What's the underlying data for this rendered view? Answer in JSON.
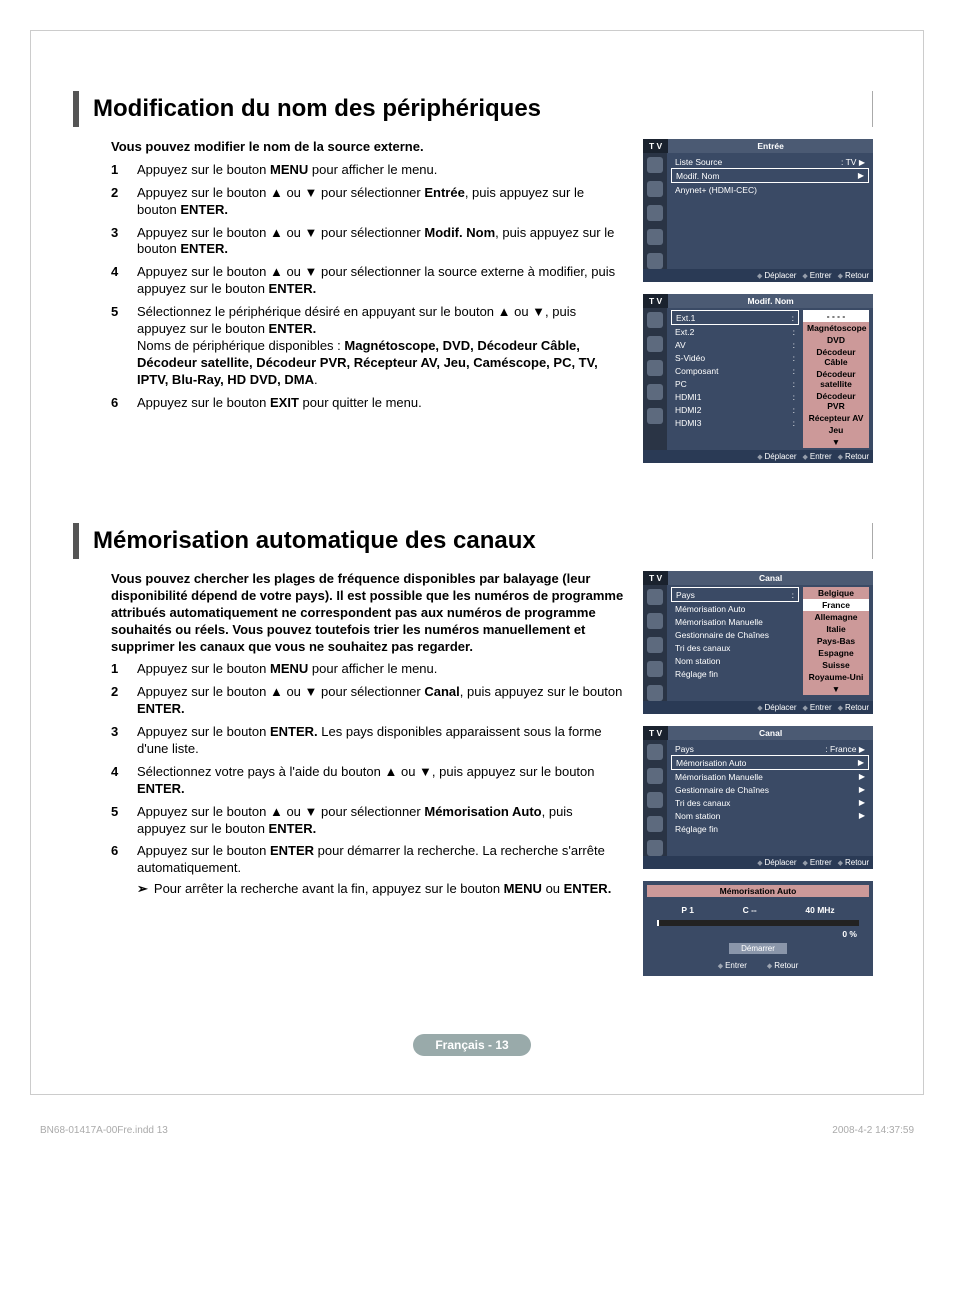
{
  "section1": {
    "title": "Modification du nom des périphériques",
    "intro": "Vous pouvez modifier le nom de la source externe.",
    "steps": [
      {
        "num": "1",
        "parts": [
          "Appuyez sur le bouton ",
          "MENU",
          " pour afficher le menu."
        ]
      },
      {
        "num": "2",
        "parts": [
          "Appuyez sur le bouton ▲ ou ▼ pour sélectionner ",
          "Entrée",
          ", puis appuyez sur le bouton ",
          "ENTER."
        ]
      },
      {
        "num": "3",
        "parts": [
          "Appuyez sur le bouton ▲ ou ▼ pour sélectionner ",
          "Modif. Nom",
          ", puis appuyez sur le bouton ",
          "ENTER."
        ]
      },
      {
        "num": "4",
        "parts": [
          "Appuyez sur le bouton ▲ ou ▼ pour sélectionner la source externe à modifier, puis appuyez sur le bouton ",
          "ENTER."
        ]
      },
      {
        "num": "5",
        "parts": [
          "Sélectionnez le périphérique désiré en appuyant sur le bouton ▲ ou ▼, puis appuyez sur le bouton ",
          "ENTER."
        ],
        "extra_intro": "Noms de périphérique disponibles : ",
        "extra_bold": "Magnétoscope, DVD, Décodeur Câble, Décodeur satellite, Décodeur PVR, Récepteur AV, Jeu, Caméscope, PC, TV, IPTV, Blu-Ray, HD DVD, DMA",
        "extra_suffix": "."
      },
      {
        "num": "6",
        "parts": [
          "Appuyez sur le bouton ",
          "EXIT",
          " pour quitter le menu."
        ]
      }
    ],
    "shot1": {
      "tab": "T V",
      "title": "Entrée",
      "rows": [
        {
          "label": "Liste Source",
          "val": ": TV",
          "arrow": "▶"
        },
        {
          "label": "Modif. Nom",
          "val": "",
          "arrow": "▶",
          "hl": true
        },
        {
          "label": "Anynet+ (HDMI-CEC)",
          "val": "",
          "arrow": ""
        }
      ]
    },
    "shot2": {
      "tab": "T V",
      "title": "Modif. Nom",
      "left": [
        "Ext.1",
        "Ext.2",
        "AV",
        "S-Vidéo",
        "Composant",
        "PC",
        "HDMI1",
        "HDMI2",
        "HDMI3"
      ],
      "right": [
        "- - - -",
        "Magnétoscope",
        "DVD",
        "Décodeur Câble",
        "Décodeur satellite",
        "Décodeur PVR",
        "Récepteur AV",
        "Jeu",
        "▼"
      ]
    },
    "footer": {
      "move": "Déplacer",
      "enter": "Entrer",
      "return": "Retour"
    }
  },
  "section2": {
    "title": "Mémorisation automatique des canaux",
    "intro": "Vous pouvez chercher les plages de fréquence disponibles par balayage (leur disponibilité dépend de votre pays). Il est possible que les numéros de programme attribués automatiquement ne correspondent pas aux numéros de programme souhaités ou réels. Vous pouvez toutefois trier les numéros manuellement et supprimer les canaux que vous ne souhaitez pas regarder.",
    "steps": [
      {
        "num": "1",
        "parts": [
          "Appuyez sur le bouton ",
          "MENU",
          " pour afficher le menu."
        ]
      },
      {
        "num": "2",
        "parts": [
          "Appuyez sur le bouton ▲ ou ▼ pour sélectionner ",
          "Canal",
          ", puis appuyez sur le bouton ",
          "ENTER."
        ]
      },
      {
        "num": "3",
        "parts": [
          "Appuyez sur le bouton ",
          "ENTER.",
          " Les pays disponibles apparaissent sous la forme d'une liste."
        ]
      },
      {
        "num": "4",
        "parts": [
          "Sélectionnez votre pays à l'aide du bouton ▲ ou ▼, puis appuyez sur le bouton ",
          "ENTER."
        ]
      },
      {
        "num": "5",
        "parts": [
          "Appuyez sur le bouton ▲ ou ▼ pour sélectionner ",
          "Mémorisation Auto",
          ", puis appuyez sur le bouton ",
          "ENTER."
        ]
      },
      {
        "num": "6",
        "parts": [
          "Appuyez sur le bouton ",
          "ENTER",
          " pour démarrer la recherche. La recherche s'arrête automatiquement."
        ],
        "sub": "Pour arrêter la recherche avant la fin, appuyez sur le bouton ",
        "sub_bold": "MENU",
        "sub_mid": " ou ",
        "sub_bold2": "ENTER."
      }
    ],
    "shot1": {
      "tab": "T V",
      "title": "Canal",
      "left": [
        "Pays",
        "Mémorisation Auto",
        "Mémorisation Manuelle",
        "Gestionnaire de Chaînes",
        "Tri des canaux",
        "Nom station",
        "Réglage fin"
      ],
      "right": [
        "Belgique",
        "France",
        "Allemagne",
        "Italie",
        "Pays-Bas",
        "Espagne",
        "Suisse",
        "Royaume-Uni",
        "▼"
      ]
    },
    "shot2": {
      "tab": "T V",
      "title": "Canal",
      "rows": [
        {
          "label": "Pays",
          "val": ": France",
          "arrow": "▶"
        },
        {
          "label": "Mémorisation Auto",
          "val": "",
          "arrow": "▶",
          "hl": true
        },
        {
          "label": "Mémorisation Manuelle",
          "val": "",
          "arrow": "▶"
        },
        {
          "label": "Gestionnaire de Chaînes",
          "val": "",
          "arrow": "▶"
        },
        {
          "label": "Tri des canaux",
          "val": "",
          "arrow": "▶"
        },
        {
          "label": "Nom station",
          "val": "",
          "arrow": "▶"
        },
        {
          "label": "Réglage fin",
          "val": "",
          "arrow": ""
        }
      ]
    },
    "shot3": {
      "title": "Mémorisation Auto",
      "p": "P  1",
      "c": "C   --",
      "mhz": "40 MHz",
      "pct": "0  %",
      "btn": "Démarrer"
    }
  },
  "page_label": "Français - 13",
  "print_foot": {
    "left": "BN68-01417A-00Fre.indd   13",
    "right": "2008-4-2   14:37:59"
  }
}
